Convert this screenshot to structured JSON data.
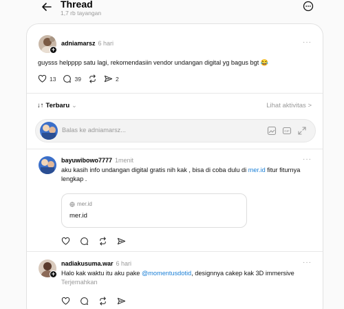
{
  "header": {
    "title": "Thread",
    "views": "1,7 rb tayangan"
  },
  "post": {
    "username": "adniamarsz",
    "time": "6 hari",
    "text": "guysss helpppp satu lagi, rekomendasiin vendor undangan digital yg bagus bgt 😂",
    "likes": "13",
    "comments": "39",
    "shares": "2"
  },
  "sort": {
    "label": "Terbaru",
    "activity": "Lihat aktivitas >"
  },
  "reply": {
    "placeholder": "Balas ke adniamarsz..."
  },
  "comments": [
    {
      "username": "bayuwibowo7777",
      "time": "1menit",
      "text_a": "aku kasih info undangan digital gratis nih kak , bisa di coba dulu di ",
      "link": "mer.id",
      "text_b": " fitur fiturnya lengkap .",
      "card_host": "mer.id",
      "card_label": "mer.id"
    },
    {
      "username": "nadiakusuma.war",
      "time": "6 hari",
      "text_a": "Halo kak waktu itu aku pake ",
      "mention": "@momentusdotid",
      "text_b": ", designnya cakep kak 3D immersive",
      "translate": "Terjemahkan"
    }
  ]
}
